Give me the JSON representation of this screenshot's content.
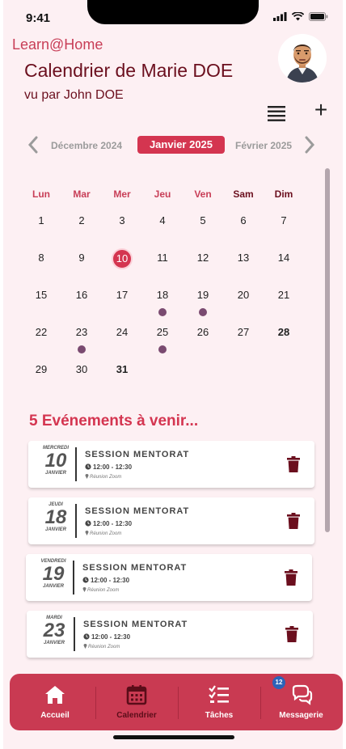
{
  "status_bar": {
    "time": "9:41"
  },
  "header": {
    "brand": "Learn@Home",
    "title": "Calendrier de Marie DOE",
    "subtitle": "vu par John DOE",
    "add_label": "+"
  },
  "month_nav": {
    "prev": "Décembre 2024",
    "current": "Janvier 2025",
    "next": "Février 2025"
  },
  "calendar": {
    "weekdays": [
      "Lun",
      "Mar",
      "Mer",
      "Jeu",
      "Ven",
      "Sam",
      "Dim"
    ],
    "weeks": [
      [
        "1",
        "2",
        "3",
        "4",
        "5",
        "6",
        "7"
      ],
      [
        "8",
        "9",
        "10",
        "11",
        "12",
        "13",
        "14"
      ],
      [
        "15",
        "16",
        "17",
        "18",
        "19",
        "20",
        "21"
      ],
      [
        "22",
        "23",
        "24",
        "25",
        "26",
        "27",
        "28"
      ],
      [
        "29",
        "30",
        "31",
        "",
        "",
        "",
        ""
      ]
    ],
    "today": "10",
    "event_days": [
      "18",
      "19",
      "23",
      "25"
    ],
    "bold_days": [
      "28",
      "31"
    ]
  },
  "events_section": {
    "title": "5 Evénements à venir...",
    "events": [
      {
        "weekday": "MERCREDI",
        "day": "10",
        "month": "JANVIER",
        "title": "SESSION MENTORAT",
        "time": "12:00 - 12:30",
        "place": "Réunion Zoom"
      },
      {
        "weekday": "JEUDI",
        "day": "18",
        "month": "JANVIER",
        "title": "SESSION MENTORAT",
        "time": "12:00 - 12:30",
        "place": "Réunion Zoom"
      },
      {
        "weekday": "VENDREDI",
        "day": "19",
        "month": "JANVIER",
        "title": "SESSION MENTORAT",
        "time": "12:00 - 12:30",
        "place": "Réunion Zoom"
      },
      {
        "weekday": "MARDI",
        "day": "23",
        "month": "JANVIER",
        "title": "SESSION MENTORAT",
        "time": "12:00 - 12:30",
        "place": "Réunion Zoom"
      }
    ]
  },
  "tabbar": {
    "tabs": [
      {
        "label": "Accueil",
        "icon": "home-icon"
      },
      {
        "label": "Calendrier",
        "icon": "calendar-icon"
      },
      {
        "label": "Tâches",
        "icon": "tasks-icon"
      },
      {
        "label": "Messagerie",
        "icon": "chat-icon"
      }
    ],
    "messages_badge": "12"
  },
  "colors": {
    "accent": "#d43550",
    "dark": "#6b0f1e",
    "event_dot": "#7a4a70",
    "tabbar": "#c93a52"
  }
}
